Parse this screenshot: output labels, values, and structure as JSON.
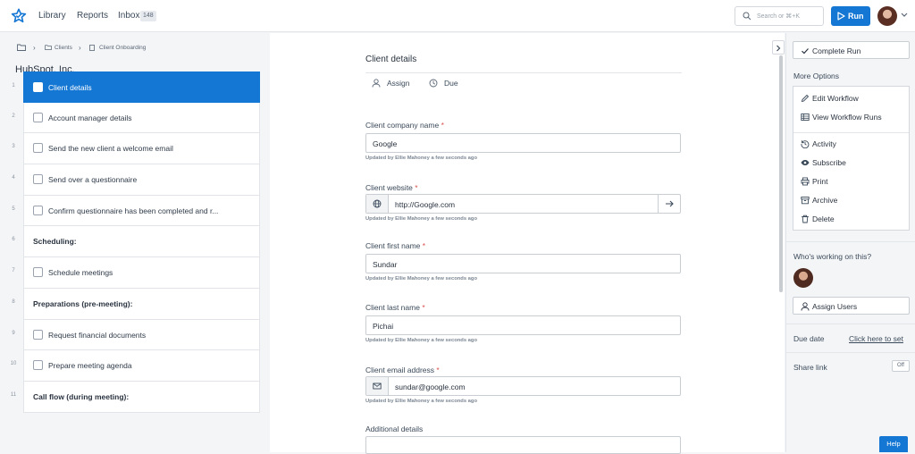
{
  "topbar": {
    "nav": [
      "Library",
      "Reports",
      "Inbox"
    ],
    "inbox_count": "148",
    "search_placeholder": "Search or ⌘+K",
    "run_label": "Run"
  },
  "breadcrumb": [
    "Clients",
    "Client Onboarding"
  ],
  "run_title": "HubSpot, Inc.",
  "steps": [
    {
      "num": "1",
      "label": "Client details",
      "type": "task",
      "active": true
    },
    {
      "num": "2",
      "label": "Account manager details",
      "type": "task"
    },
    {
      "num": "3",
      "label": "Send the new client a welcome email",
      "type": "task"
    },
    {
      "num": "4",
      "label": "Send over a questionnaire",
      "type": "task"
    },
    {
      "num": "5",
      "label": "Confirm questionnaire has been completed and r...",
      "type": "task"
    },
    {
      "num": "6",
      "label": "Scheduling:",
      "type": "heading"
    },
    {
      "num": "7",
      "label": "Schedule meetings",
      "type": "task"
    },
    {
      "num": "8",
      "label": "Preparations (pre-meeting):",
      "type": "heading"
    },
    {
      "num": "9",
      "label": "Request financial documents",
      "type": "task"
    },
    {
      "num": "10",
      "label": "Prepare meeting agenda",
      "type": "task"
    },
    {
      "num": "11",
      "label": "Call flow (during meeting):",
      "type": "heading"
    }
  ],
  "form": {
    "section_title": "Client details",
    "assign_label": "Assign",
    "due_label": "Due",
    "fields": [
      {
        "label": "Client company name",
        "value": "Google",
        "updated": "Updated by Ellie Mahoney a few seconds ago"
      },
      {
        "label": "Client website",
        "value": "http://Google.com",
        "updated": "Updated by Ellie Mahoney a few seconds ago"
      },
      {
        "label": "Client first name",
        "value": "Sundar",
        "updated": "Updated by Ellie Mahoney a few seconds ago"
      },
      {
        "label": "Client last name",
        "value": "Pichai",
        "updated": "Updated by Ellie Mahoney a few seconds ago"
      },
      {
        "label": "Client email address",
        "value": "sundar@google.com",
        "updated": "Updated by Ellie Mahoney a few seconds ago"
      }
    ],
    "required_mark": "*",
    "additional_label": "Additional details"
  },
  "sidebar": {
    "complete_run": "Complete Run",
    "more_options": "More Options",
    "menu": [
      "Edit Workflow",
      "View Workflow Runs",
      "Activity",
      "Subscribe",
      "Print",
      "Archive",
      "Delete"
    ],
    "working_label": "Who's working on this?",
    "assign_users": "Assign Users",
    "due_date_label": "Due date",
    "due_date_link": "Click here to set",
    "share_link_label": "Share link",
    "share_toggle": "Off"
  },
  "help_label": "Help",
  "colors": {
    "accent": "#1577d4",
    "required": "#d9534f"
  }
}
